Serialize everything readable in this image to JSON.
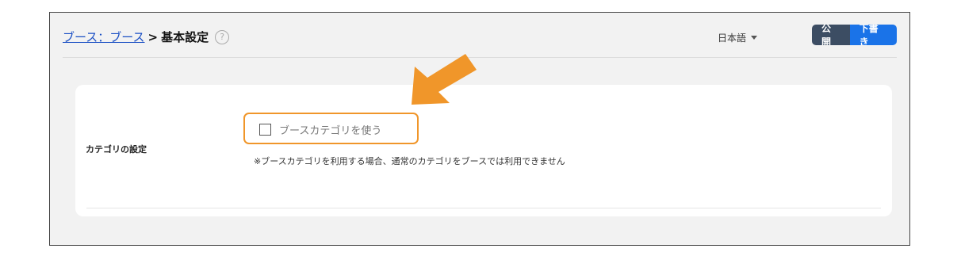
{
  "breadcrumb": {
    "link_label": "ブース：ブース",
    "separator": ">",
    "current_label": "基本設定",
    "help_icon": "?"
  },
  "language": {
    "label": "日本語"
  },
  "status": {
    "public_label": "公開",
    "draft_label": "下書き"
  },
  "category": {
    "row_label": "カテゴリの設定",
    "checkbox_label": "ブースカテゴリを使う",
    "checkbox_checked": false,
    "note": "※ブースカテゴリを利用する場合、通常のカテゴリをブースでは利用できません"
  },
  "colors": {
    "highlight": "#f0962a",
    "link": "#1a4fc4",
    "draft": "#1a73e8",
    "public": "#3c4d63"
  },
  "icons": [
    "help-icon",
    "caret-down-icon",
    "checkbox",
    "pointer-arrow"
  ]
}
